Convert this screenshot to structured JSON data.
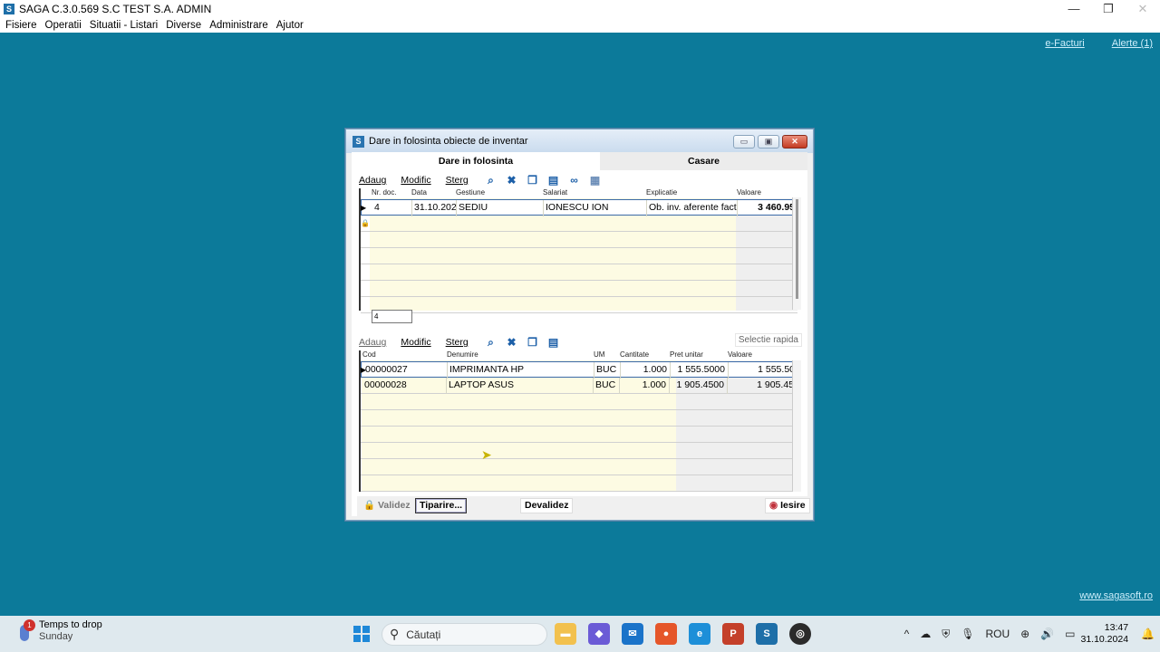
{
  "app": {
    "title": "SAGA C.3.0.569  S.C TEST S.A.  ADMIN"
  },
  "window_controls": {
    "minimize": "—",
    "restore": "❐",
    "close": "✕"
  },
  "menu": [
    "Fisiere",
    "Operatii",
    "Situatii - Listari",
    "Diverse",
    "Administrare",
    "Ajutor"
  ],
  "desktop_links": {
    "efacturi": "e-Facturi",
    "alerte": "Alerte (1)",
    "website": "www.sagasoft.ro"
  },
  "dialog": {
    "title": "Dare in folosinta obiecte de inventar",
    "tabs": [
      "Dare in folosinta",
      "Casare"
    ],
    "top_toolbar": {
      "adaug": "Adaug",
      "modific": "Modific",
      "sterg": "Sterg"
    },
    "top_columns": [
      "Nr. doc.",
      "Data",
      "Gestiune",
      "Salariat",
      "Explicatie",
      "Valoare"
    ],
    "top_rows": [
      {
        "nr": "4",
        "data": "31.10.202",
        "gestiune": "SEDIU",
        "salariat": "IONESCU ION",
        "explicatie": "Ob. inv. aferente factu",
        "valoare": "3 460.95"
      }
    ],
    "counter": "4",
    "bottom_toolbar": {
      "adaug": "Adaug",
      "modific": "Modific",
      "sterg": "Sterg",
      "selectie": "Selectie rapida"
    },
    "bottom_columns": [
      "Cod",
      "Denumire",
      "UM",
      "Cantitate",
      "Pret unitar",
      "Valoare"
    ],
    "bottom_rows": [
      {
        "cod": "00000027",
        "denumire": "IMPRIMANTA HP",
        "um": "BUC",
        "cantitate": "1.000",
        "pret": "1 555.5000",
        "valoare": "1 555.50"
      },
      {
        "cod": "00000028",
        "denumire": "LAPTOP ASUS",
        "um": "BUC",
        "cantitate": "1.000",
        "pret": "1 905.4500",
        "valoare": "1 905.45"
      }
    ],
    "buttons": {
      "validez": "Validez",
      "tiparire": "Tiparire...",
      "devalidez": "Devalidez",
      "iesire": "Iesire"
    }
  },
  "taskbar": {
    "weather_title": "Temps to drop",
    "weather_sub": "Sunday",
    "weather_badge": "1",
    "search_placeholder": "Căutați",
    "language": "ROU",
    "time": "13:47",
    "date": "31.10.2024"
  }
}
